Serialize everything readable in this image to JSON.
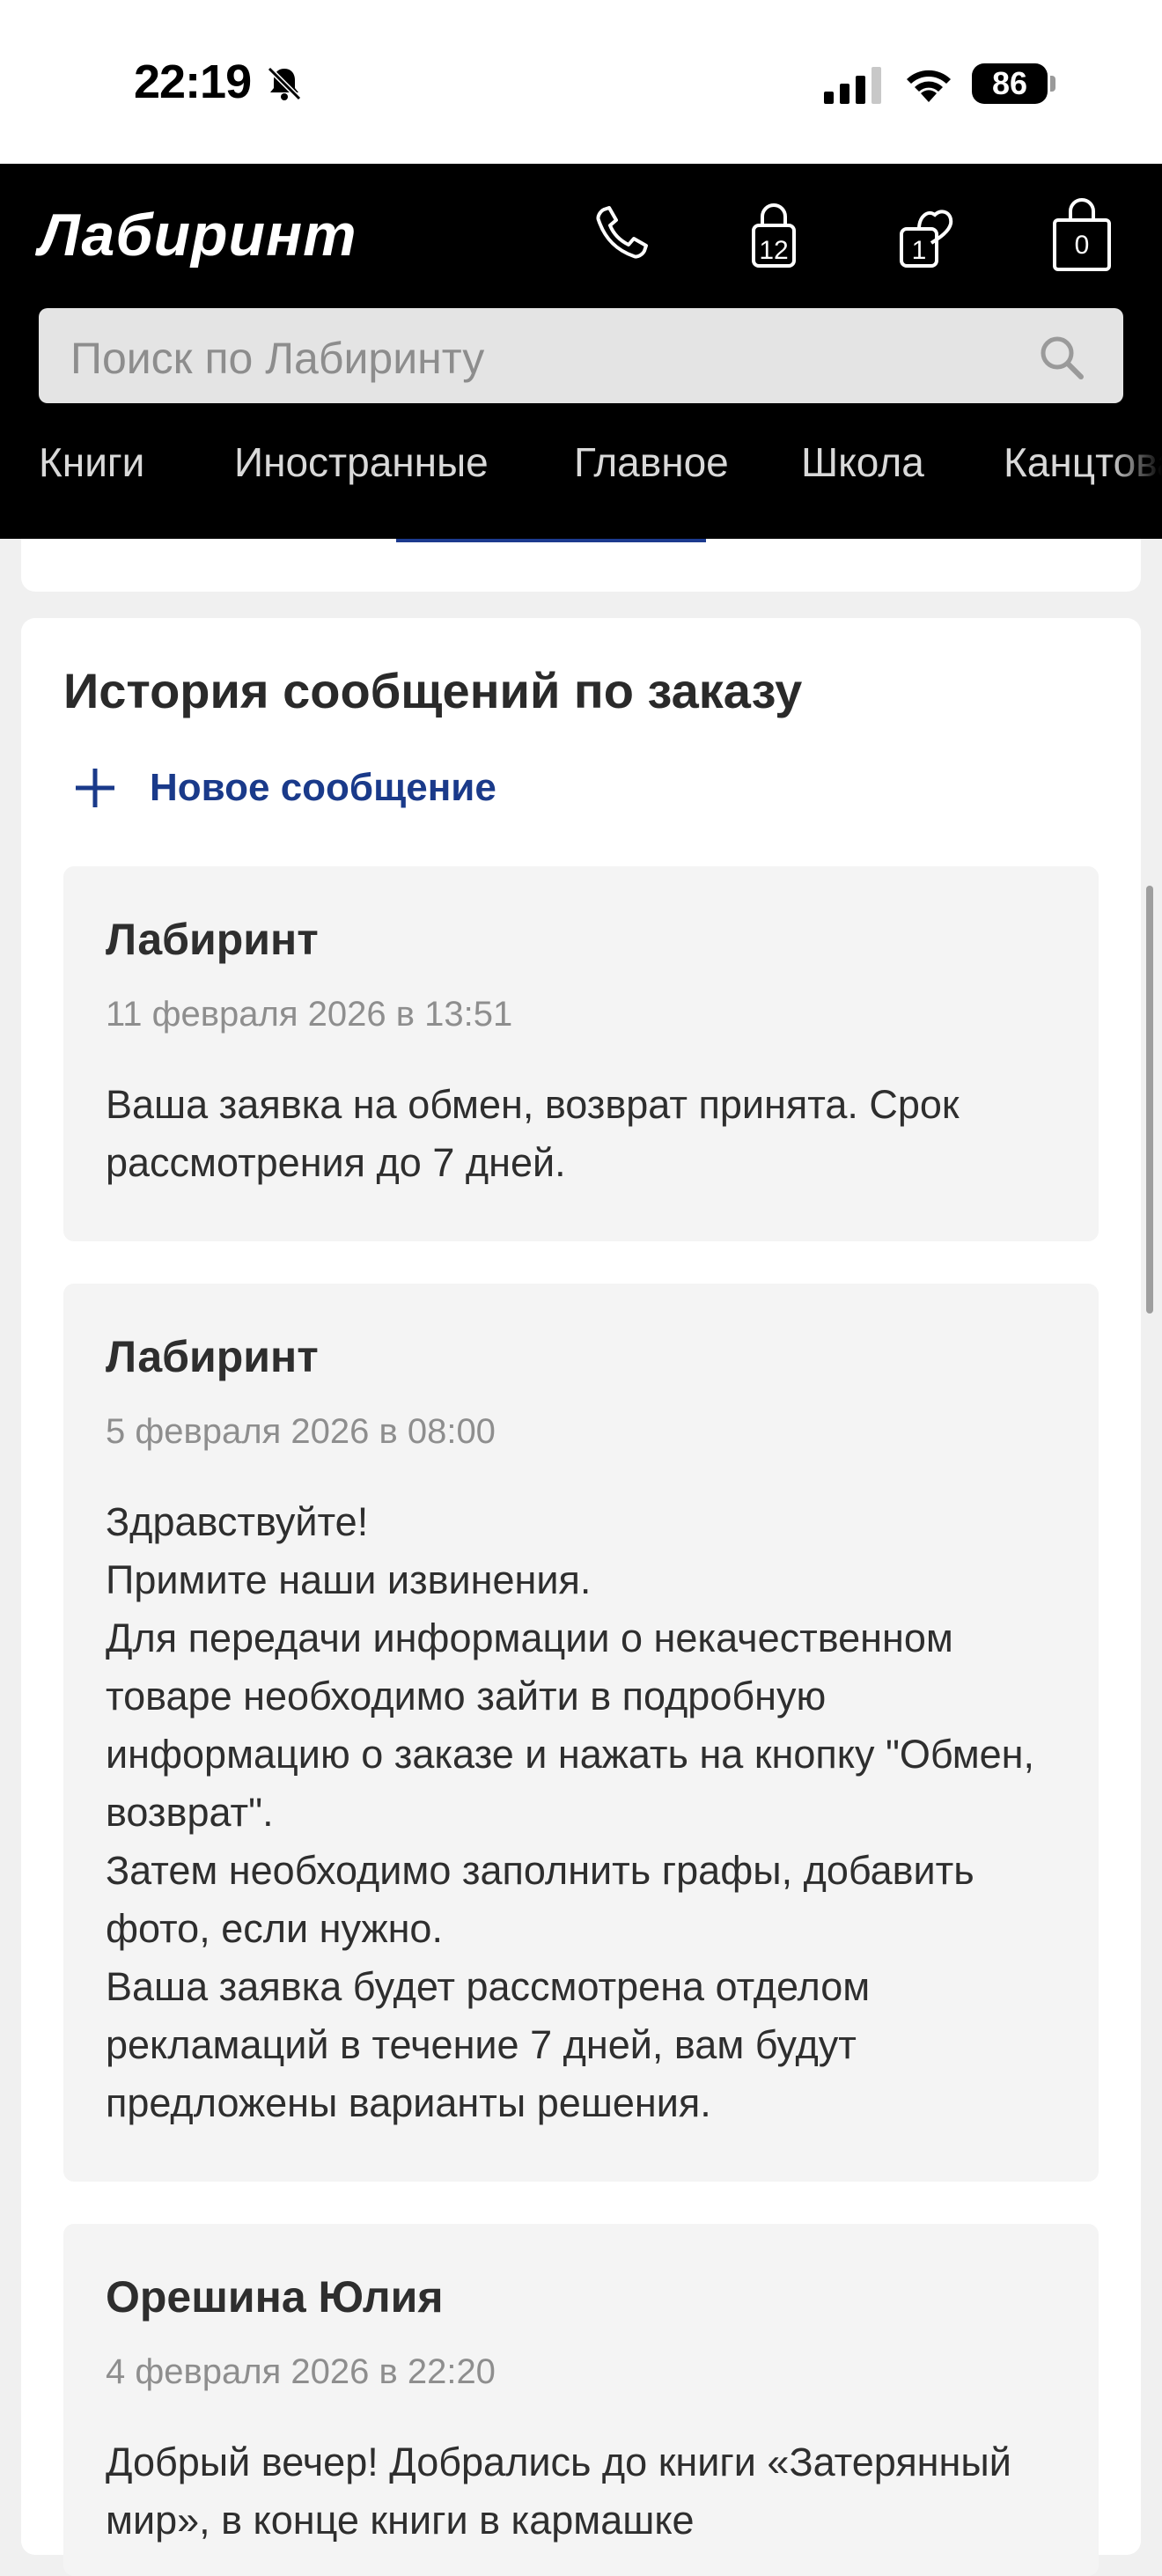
{
  "status_bar": {
    "time": "22:19",
    "battery": "86",
    "icons": [
      "bell-slash-icon",
      "signal-icon",
      "wifi-icon",
      "battery-icon"
    ]
  },
  "header": {
    "logo": "Лабиринт",
    "icons": {
      "phone": "phone-icon",
      "orders": {
        "icon": "lock-bag-icon",
        "count": "12"
      },
      "favorites": {
        "icon": "heart-bag-icon",
        "count": "1"
      },
      "cart": {
        "icon": "cart-bag-icon",
        "count": "0"
      }
    },
    "search": {
      "placeholder": "Поиск по Лабиринту"
    },
    "nav": [
      "Книги",
      "Иностранные",
      "Главное",
      "Школа",
      "Канцтовары"
    ]
  },
  "messages_section": {
    "title": "История сообщений по заказу",
    "new_message_label": "Новое сообщение",
    "messages": [
      {
        "author": "Лабиринт",
        "date": "11 февраля 2026 в 13:51",
        "text": "Ваша заявка на обмен, возврат принята. Срок рассмотрения до 7 дней."
      },
      {
        "author": "Лабиринт",
        "date": "5 февраля 2026 в 08:00",
        "text": "Здравствуйте!\nПримите наши извинения.\nДля передачи информации о некачественном товаре необходимо зайти в подробную информацию о заказе и нажать на кнопку \"Обмен, возврат\".\nЗатем необходимо заполнить графы, добавить фото, если нужно.\nВаша заявка будет рассмотрена отделом рекламаций в течение 7 дней, вам будут предложены варианты решения."
      },
      {
        "author": "Орешина Юлия",
        "date": "4 февраля 2026 в 22:20",
        "text": "Добрый вечер! Добрались до книги «Затерянный мир», в конце книги в кармашке"
      }
    ]
  },
  "colors": {
    "header_bg": "#000000",
    "accent": "#1a3a8a",
    "message_bg": "#f4f4f4"
  }
}
